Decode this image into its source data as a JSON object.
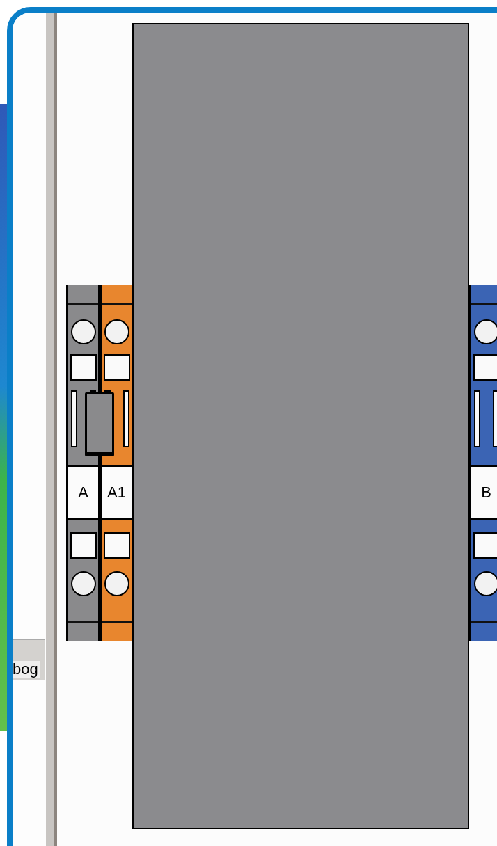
{
  "side_panel": {
    "label": "bog"
  },
  "terminals": [
    {
      "label": "A",
      "color": "#8a8a8c",
      "bridged_to_next": true
    },
    {
      "label": "A1",
      "color": "#e8862e",
      "bridged_to_next": false
    },
    {
      "label": "B",
      "color": "#3b64b4",
      "bridged_to_next": false
    }
  ]
}
